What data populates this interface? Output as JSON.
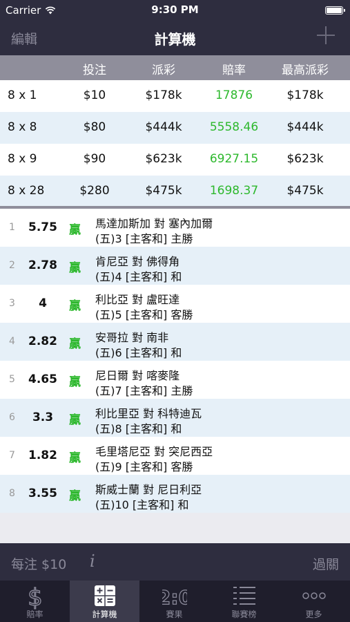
{
  "status": {
    "carrier": "Carrier",
    "time": "9:30 PM"
  },
  "nav": {
    "edit_label": "編輯",
    "title": "計算機"
  },
  "table": {
    "headers": [
      "投注",
      "派彩",
      "賠率",
      "最高派彩"
    ],
    "rows": [
      {
        "combo": "8 x 1",
        "stake": "$10",
        "payout": "$178k",
        "odds": "17876",
        "max_payout": "$178k"
      },
      {
        "combo": "8 x 8",
        "stake": "$80",
        "payout": "$444k",
        "odds": "5558.46",
        "max_payout": "$444k"
      },
      {
        "combo": "8 x 9",
        "stake": "$90",
        "payout": "$623k",
        "odds": "6927.15",
        "max_payout": "$623k"
      },
      {
        "combo": "8 x 28",
        "stake": "$280",
        "payout": "$475k",
        "odds": "1698.37",
        "max_payout": "$475k"
      }
    ]
  },
  "legs": [
    {
      "index": "1",
      "odds": "5.75",
      "result": "贏",
      "match": "馬達加斯加 對 塞內加爾",
      "bet": "(五)3 [主客和] 主勝"
    },
    {
      "index": "2",
      "odds": "2.78",
      "result": "贏",
      "match": "肯尼亞 對 佛得角",
      "bet": "(五)4 [主客和] 和"
    },
    {
      "index": "3",
      "odds": "4",
      "result": "贏",
      "match": "利比亞 對 盧旺達",
      "bet": "(五)5 [主客和] 客勝"
    },
    {
      "index": "4",
      "odds": "2.82",
      "result": "贏",
      "match": "安哥拉 對 南非",
      "bet": "(五)6 [主客和] 和"
    },
    {
      "index": "5",
      "odds": "4.65",
      "result": "贏",
      "match": "尼日爾 對 喀麥隆",
      "bet": "(五)7 [主客和] 主勝"
    },
    {
      "index": "6",
      "odds": "3.3",
      "result": "贏",
      "match": "利比里亞 對 科特迪瓦",
      "bet": "(五)8 [主客和] 和"
    },
    {
      "index": "7",
      "odds": "1.82",
      "result": "贏",
      "match": "毛里塔尼亞 對 突尼西亞",
      "bet": "(五)9 [主客和] 客勝"
    },
    {
      "index": "8",
      "odds": "3.55",
      "result": "贏",
      "match": "斯威士蘭 對 尼日利亞",
      "bet": "(五)10 [主客和] 和"
    }
  ],
  "bottom": {
    "stake_label": "每注 $10",
    "info_label": "i",
    "parlay_label": "過關"
  },
  "tabs": [
    {
      "label": "賠率",
      "icon": "dollar-icon",
      "active": false
    },
    {
      "label": "計算機",
      "icon": "calculator-icon",
      "active": true
    },
    {
      "label": "賽果",
      "icon": "scoreboard-icon",
      "active": false
    },
    {
      "label": "聯賽榜",
      "icon": "standings-list-icon",
      "active": false
    },
    {
      "label": "更多",
      "icon": "more-icon",
      "active": false
    }
  ],
  "colors": {
    "bar": "#2e2d3f",
    "tabbar": "#1f1e2c",
    "header": "#8f8e9b",
    "green": "#2db82d",
    "row_alt": "#e6f0f8"
  }
}
